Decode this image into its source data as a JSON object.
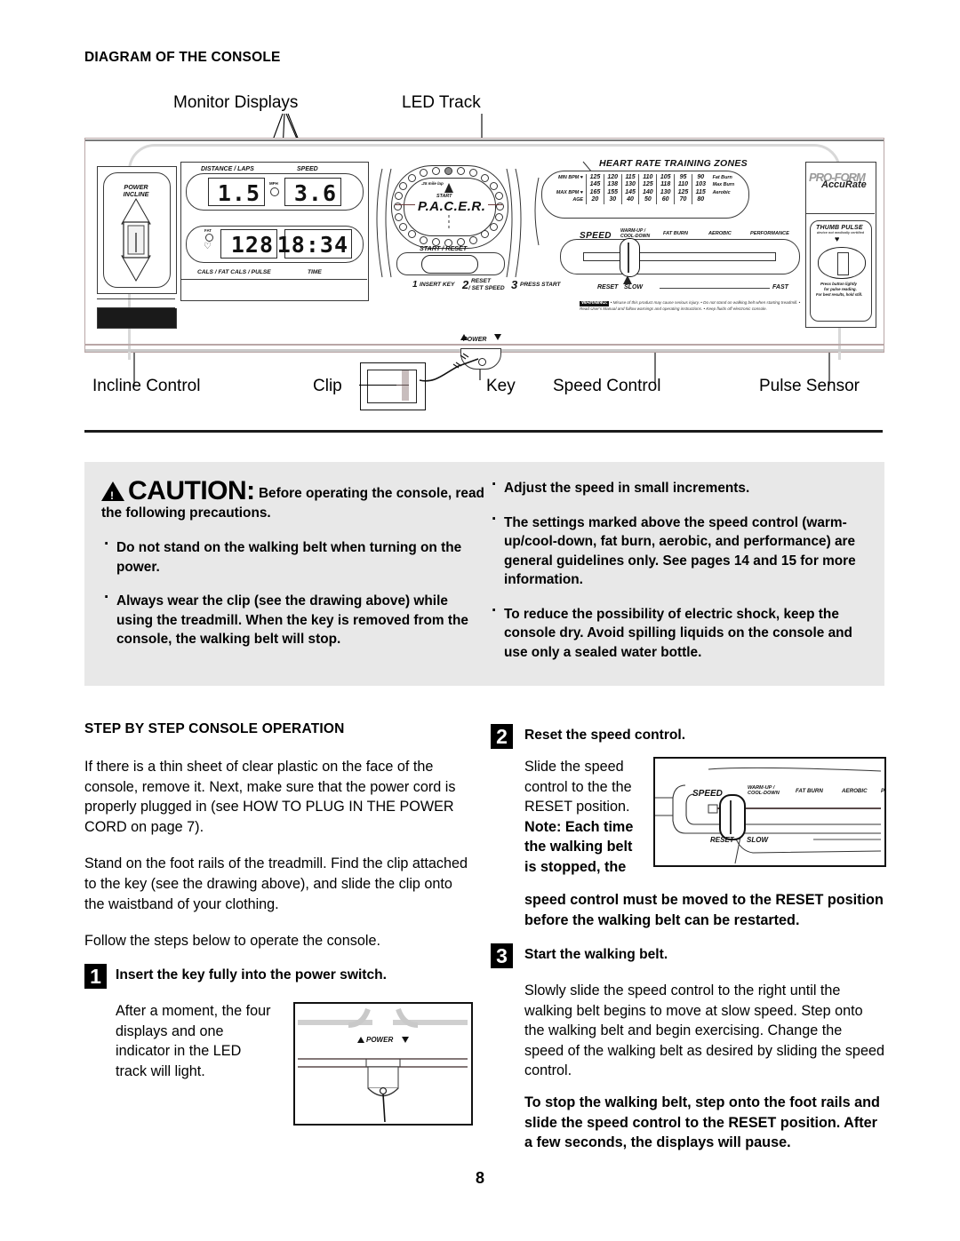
{
  "section_titles": {
    "diagram": "DIAGRAM OF THE CONSOLE",
    "steps": "STEP BY STEP CONSOLE OPERATION"
  },
  "callouts": {
    "monitor_displays": "Monitor Displays",
    "led_track": "LED Track",
    "incline_control": "Incline Control",
    "clip": "Clip",
    "key": "Key",
    "speed_control": "Speed Control",
    "pulse_sensor": "Pulse Sensor"
  },
  "console": {
    "incline": {
      "line1": "POWER",
      "line2": "INCLINE"
    },
    "displays": {
      "top_left_label": "DISTANCE / LAPS",
      "top_right_label": "SPEED",
      "bottom_left_label": "CALS / FAT CALS / PULSE",
      "bottom_right_label": "TIME",
      "distance_value": "1.5",
      "speed_value": "3.6",
      "cals_value": "128",
      "time_value": "18:34",
      "mph_indicator": "MPH",
      "fat_indicator": "FAT"
    },
    "pacer": {
      "brand": "P.A.C.E.R.",
      "lap_text": ".25 mile lap",
      "start": "START",
      "start_reset_button": "START / RESET"
    },
    "steps_strip": [
      {
        "num": "1",
        "label": "INSERT KEY"
      },
      {
        "num": "2",
        "label": "RESET\n/ SET SPEED"
      },
      {
        "num": "3",
        "label": "PRESS START"
      }
    ],
    "heart_rate": {
      "title": "HEART RATE TRAINING ZONES",
      "row_labels": [
        "MIN BPM",
        "",
        "MAX BPM",
        "AGE"
      ],
      "zone_labels": [
        "Fat Burn",
        "Max Burn",
        "Aerobic",
        ""
      ],
      "rows": [
        [
          "125",
          "120",
          "115",
          "110",
          "105",
          "95",
          "90"
        ],
        [
          "145",
          "138",
          "130",
          "125",
          "118",
          "110",
          "103"
        ],
        [
          "165",
          "155",
          "145",
          "140",
          "130",
          "125",
          "115"
        ],
        [
          "20",
          "30",
          "40",
          "50",
          "60",
          "70",
          "80"
        ]
      ]
    },
    "speed_control": {
      "title": "SPEED",
      "zones": [
        "WARM-UP /\nCOOL-DOWN",
        "FAT BURN",
        "AEROBIC",
        "PERFORMANCE"
      ],
      "reset": "RESET",
      "slow": "SLOW",
      "fast": "FAST"
    },
    "warning": {
      "label": "WARNING:",
      "text": "• Misuse of this product may cause serious injury. • Do not stand on walking belt when starting treadmill. • Read User's Manual and follow warnings and operating instructions. • Keep fluids off electronic console."
    },
    "brand": {
      "name": "PRO-FORM",
      "sub": "AccuRate"
    },
    "thumb_pulse": {
      "title": "THUMB PULSE",
      "subtitle": "device not medically certified",
      "note1": "Press button lightly",
      "note2": "for pulse reading.",
      "note3": "For best results, hold still."
    },
    "power_label": "POWER"
  },
  "caution": {
    "heading_icon": "warning-triangle",
    "heading_word": "CAUTION",
    "heading_colon": ":",
    "heading_rest": "Before operating the console, read the following precautions.",
    "left_bullets": [
      "Do not stand on the walking belt when turning on the power.",
      "Always wear the clip (see the drawing above) while using the treadmill. When the key is removed from the console, the walking belt will stop."
    ],
    "right_bullets": [
      "Adjust the speed in small increments.",
      "The settings marked above the speed control (warm-up/cool-down, fat burn, aerobic, and performance) are general guidelines only. See pages 14 and 15 for more information.",
      "To reduce the possibility of electric shock, keep the console dry. Avoid spilling liquids on the console and use only a sealed water bottle."
    ]
  },
  "operation": {
    "intro_p1": "If there is a thin sheet of clear plastic on the face of the console, remove it. Next, make sure that the power cord is properly plugged in (see HOW TO PLUG IN THE POWER CORD on page 7).",
    "intro_p2": "Stand on the foot rails of the treadmill. Find the clip attached to the key (see the drawing above), and slide the clip onto the waistband of your clothing.",
    "intro_p3": "Follow the steps below to operate the console.",
    "step1": {
      "num": "1",
      "title": "Insert the key fully into the power switch.",
      "body": "After a moment, the four displays and one indicator in the LED track will light.",
      "figure_label": "POWER"
    },
    "step2": {
      "num": "2",
      "title": "Reset the speed control.",
      "body_plain_1": "Slide the speed control to the the RESET position. ",
      "body_bold_1": "Note: Each time the walking belt is stopped, the ",
      "body_bold_2": "speed control must be moved to the RESET position before the walking belt can be restarted.",
      "figure": {
        "title": "SPEED",
        "zones": [
          "WARM-UP /\nCOOL-DOWN",
          "FAT BURN",
          "AEROBIC",
          "PERF"
        ],
        "reset": "RESET",
        "slow": "SLOW"
      }
    },
    "step3": {
      "num": "3",
      "title": "Start the walking belt.",
      "body": "Slowly slide the speed control to the right until the walking belt begins to move at slow speed. Step onto the walking belt and begin exercising. Change the speed of the walking belt as desired by sliding the speed control.",
      "bold_note": "To stop the walking belt, step onto the foot rails and slide the speed control to the RESET position. After a few seconds, the displays will pause."
    }
  },
  "page_number": "8"
}
